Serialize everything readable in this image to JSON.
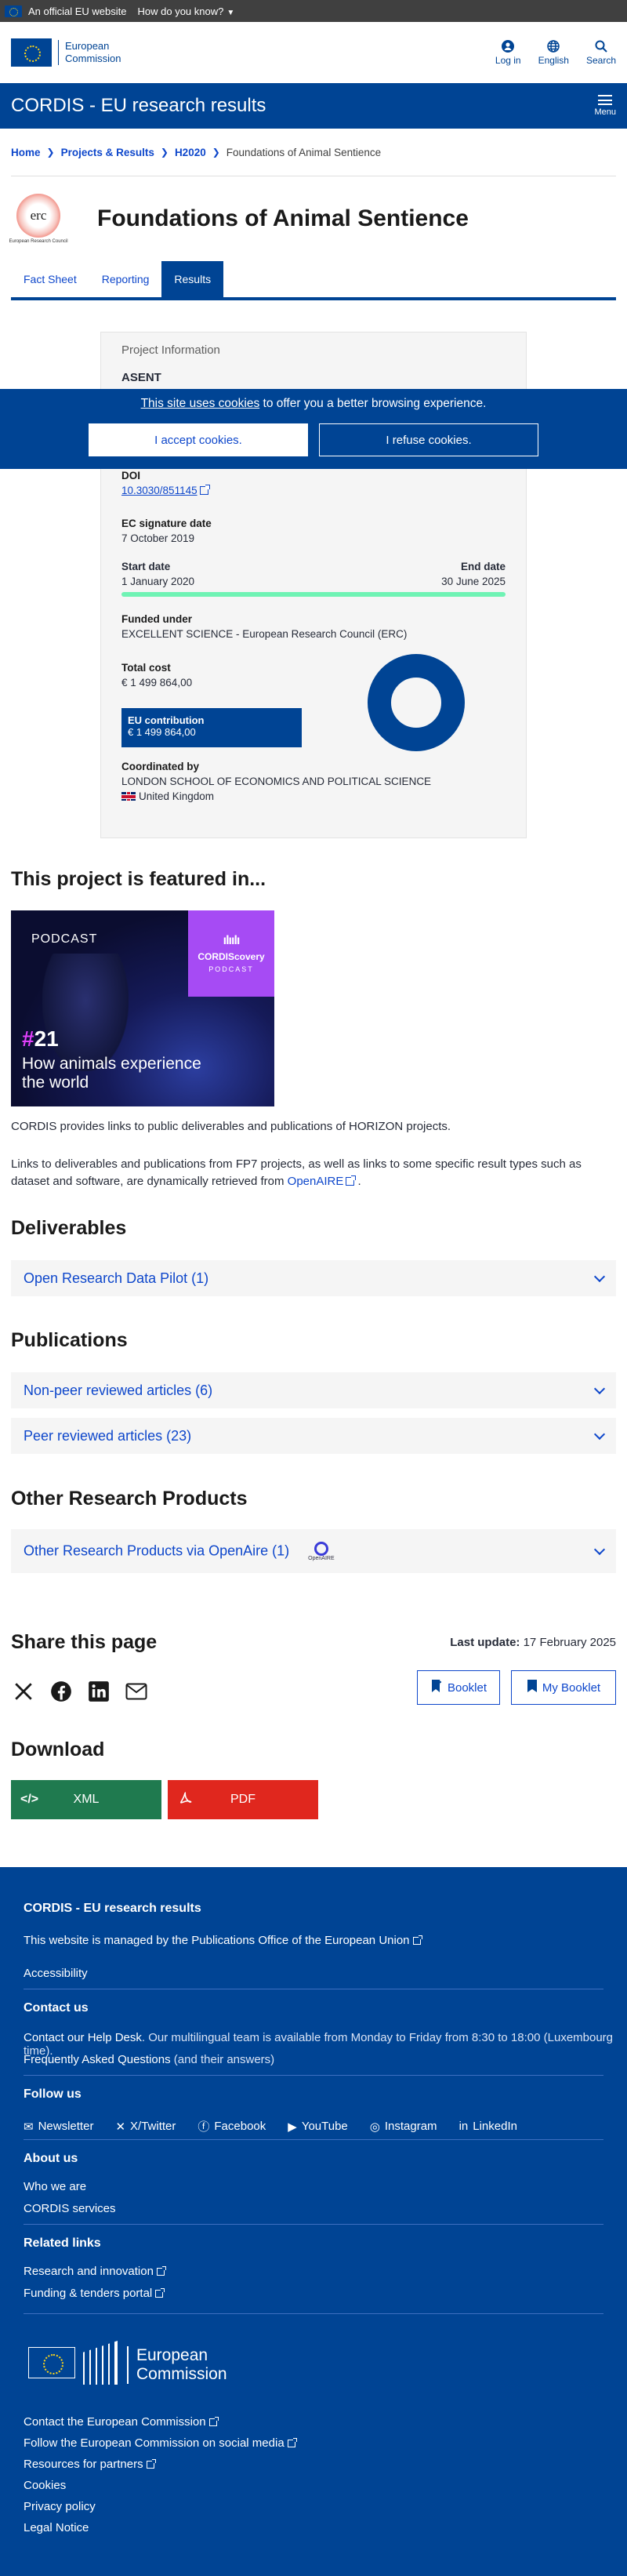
{
  "official_bar": {
    "text": "An official EU website",
    "question": "How do you know?"
  },
  "ec_header": {
    "logo_line1": "European",
    "logo_line2": "Commission",
    "login": "Log in",
    "language": "English",
    "search": "Search"
  },
  "cordis_bar": {
    "title": "CORDIS - EU research results",
    "menu": "Menu"
  },
  "breadcrumb": {
    "home": "Home",
    "projects": "Projects & Results",
    "programme": "H2020",
    "current": "Foundations of Animal Sentience"
  },
  "project": {
    "logo_text": "erc",
    "logo_sub": "European Research Council",
    "title": "Foundations of Animal Sentience"
  },
  "tabs": [
    {
      "label": "Fact Sheet"
    },
    {
      "label": "Reporting"
    },
    {
      "label": "Results"
    }
  ],
  "info": {
    "card_title": "Project Information",
    "acronym": "ASENT",
    "doi_label": "DOI",
    "doi_value": "10.3030/851145",
    "ec_sig_label": "EC signature date",
    "ec_sig_value": "7 October 2019",
    "start_label": "Start date",
    "start_value": "1 January 2020",
    "end_label": "End date",
    "end_value": "30 June 2025",
    "funded_label": "Funded under",
    "funded_value": "EXCELLENT SCIENCE - European Research Council (ERC)",
    "total_cost_label": "Total cost",
    "total_cost_value": "€ 1 499 864,00",
    "eu_contrib_label": "EU contribution",
    "eu_contrib_value": "€ 1 499 864,00",
    "coord_label": "Coordinated by",
    "coord_value": "LONDON SCHOOL OF ECONOMICS AND POLITICAL SCIENCE",
    "country": "United Kingdom",
    "colors": {
      "accent": "#004494",
      "duration_bar": "#6ff3b4"
    }
  },
  "cookie": {
    "link_text": "This site uses cookies",
    "rest_text": " to offer you a better browsing experience.",
    "accept": "I accept cookies.",
    "refuse": "I refuse cookies."
  },
  "featured": {
    "heading": "This project is featured in...",
    "podcast_label": "PODCAST",
    "badge_title": "CORDIScovery",
    "badge_sub": "PODCAST",
    "episode_hash": "#",
    "episode_num": "21",
    "caption_line1": "How animals experience",
    "caption_line2": "the world"
  },
  "paragraphs": {
    "p1": "CORDIS provides links to public deliverables and publications of HORIZON projects.",
    "p2": "Links to deliverables and publications from FP7 projects, as well as links to some specific result types such as dataset and software, are dynamically retrieved from",
    "p2_link": "OpenAIRE",
    "p2_end": " ."
  },
  "deliverables": {
    "heading": "Deliverables",
    "item": "Open Research Data Pilot (1)"
  },
  "publications": {
    "heading": "Publications",
    "item1": "Non-peer reviewed articles (6)",
    "item2": "Peer reviewed articles (23)"
  },
  "other": {
    "heading": "Other Research Products",
    "item": "Other Research Products via OpenAire (1)",
    "openaire_label": "OpenAIRE"
  },
  "share": {
    "heading": "Share this page",
    "last_update_label": "Last update:",
    "last_update_value": " 17 February 2025",
    "booklet": "Booklet",
    "my_booklet": "My Booklet"
  },
  "download": {
    "heading": "Download",
    "xml": "XML",
    "pdf": "PDF",
    "colors": {
      "xml": "#1f7a4f",
      "pdf": "#e0271e"
    }
  },
  "footer": {
    "title": "CORDIS - EU research results",
    "managed_pre": "This website is managed by the ",
    "managed_link": "Publications Office of the European Union",
    "accessibility": "Accessibility",
    "contact_h": "Contact us",
    "helpdesk_link": "Contact our Help Desk",
    "helpdesk_rest": ". Our multilingual team is available from Monday to Friday from 8:30 to 18:00 (Luxembourg time).",
    "faq_link": "Frequently Asked Questions",
    "faq_rest": " (and their answers)",
    "follow_h": "Follow us",
    "social": [
      "Newsletter",
      "X/Twitter",
      "Facebook",
      "YouTube",
      "Instagram",
      "LinkedIn"
    ],
    "about_h": "About us",
    "who": "Who we are",
    "services": "CORDIS services",
    "related_h": "Related links",
    "research": "Research and innovation",
    "funding": "Funding & tenders portal",
    "ec_line1": "European",
    "ec_line2": "Commission",
    "contact_ec": "Contact the European Commission",
    "follow_ec": "Follow the European Commission on social media",
    "partners": "Resources for partners",
    "cookies": "Cookies",
    "privacy": "Privacy policy",
    "legal": "Legal Notice"
  }
}
